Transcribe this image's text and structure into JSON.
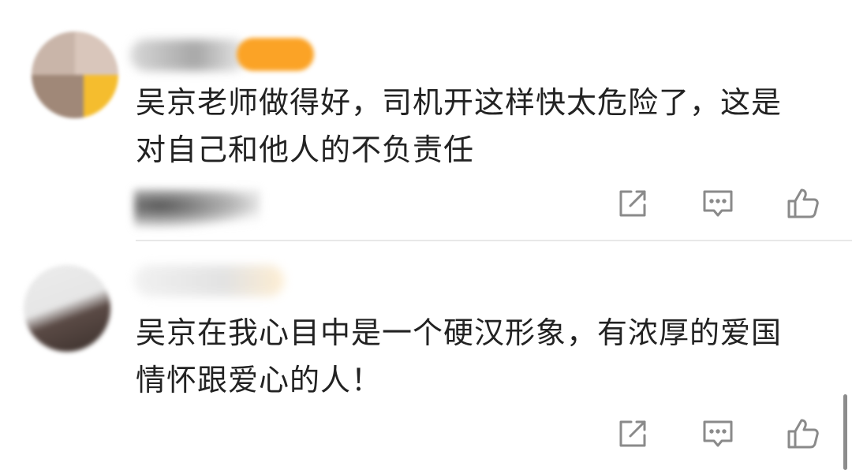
{
  "comments": [
    {
      "text_line1": "吴京老师做得好，司机开这样快太危险了，这是",
      "text_line2": "对自己和他人的不负责任"
    },
    {
      "text_line1": "吴京在我心目中是一个硬汉形象，有浓厚的爱国",
      "text_line2": "情怀跟爱心的人！"
    }
  ],
  "icons": {
    "share": "share-icon",
    "reply": "comment-icon",
    "like": "thumbs-up-icon"
  },
  "colors": {
    "badge": "#fba326",
    "icon": "#8a8a8a",
    "text": "#222222",
    "divider": "#e8e8e8"
  }
}
